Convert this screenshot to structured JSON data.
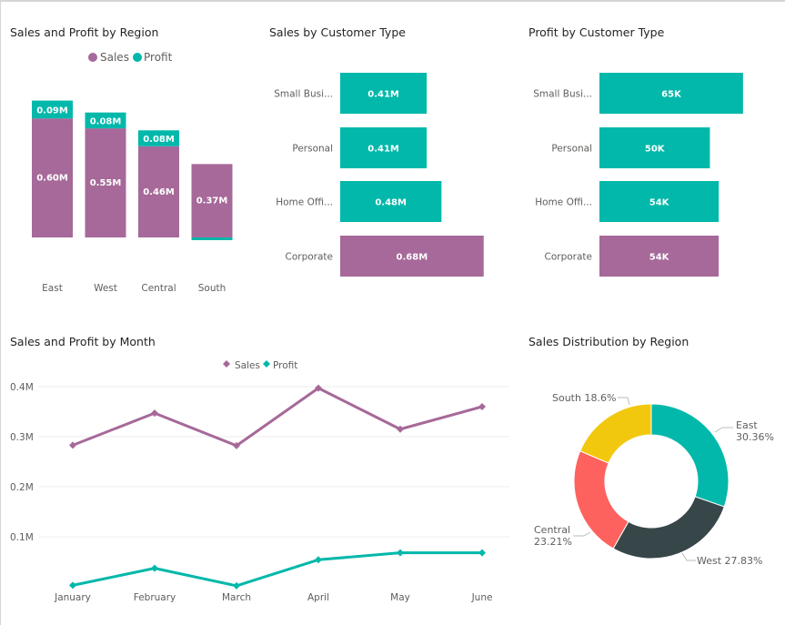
{
  "colors": {
    "sales": "#a66999",
    "profit": "#01b8aa",
    "east": "#01b8aa",
    "west": "#374649",
    "central": "#fd625e",
    "south": "#f2c80f",
    "grid": "#eeeeee",
    "axis_text": "#605e5c"
  },
  "chart_data": [
    {
      "id": "region",
      "type": "bar",
      "stacked": true,
      "title": "Sales and Profit by Region",
      "legend": {
        "position": "top-center",
        "entries": [
          "Sales",
          "Profit"
        ]
      },
      "categories": [
        "East",
        "West",
        "Central",
        "South"
      ],
      "series": [
        {
          "name": "Sales",
          "values": [
            0.6,
            0.55,
            0.46,
            0.37
          ],
          "labels": [
            "0.60M",
            "0.55M",
            "0.46M",
            "0.37M"
          ]
        },
        {
          "name": "Profit",
          "values": [
            0.09,
            0.08,
            0.08,
            -0.01
          ],
          "labels": [
            "0.09M",
            "0.08M",
            "0.08M",
            ""
          ]
        }
      ],
      "unit": "M"
    },
    {
      "id": "sales_cust",
      "type": "bar",
      "orientation": "horizontal",
      "title": "Sales by Customer Type",
      "categories": [
        "Small Busi...",
        "Personal",
        "Home Offi...",
        "Corporate"
      ],
      "values": [
        0.41,
        0.41,
        0.48,
        0.68
      ],
      "labels": [
        "0.41M",
        "0.41M",
        "0.48M",
        "0.68M"
      ],
      "highlight_index": 3,
      "xlim": [
        0,
        0.72
      ]
    },
    {
      "id": "profit_cust",
      "type": "bar",
      "orientation": "horizontal",
      "title": "Profit by Customer Type",
      "categories": [
        "Small Busi...",
        "Personal",
        "Home Offi...",
        "Corporate"
      ],
      "values": [
        65,
        50,
        54,
        54
      ],
      "labels": [
        "65K",
        "50K",
        "54K",
        "54K"
      ],
      "highlight_index": 3,
      "xlim": [
        0,
        70
      ]
    },
    {
      "id": "month",
      "type": "line",
      "title": "Sales and Profit by Month",
      "legend": {
        "position": "top-center",
        "entries": [
          "Sales",
          "Profit"
        ]
      },
      "x": [
        "January",
        "February",
        "March",
        "April",
        "May",
        "June"
      ],
      "series": [
        {
          "name": "Sales",
          "values": [
            0.283,
            0.347,
            0.282,
            0.397,
            0.315,
            0.36
          ]
        },
        {
          "name": "Profit",
          "values": [
            0.003,
            0.037,
            0.002,
            0.054,
            0.068,
            0.068
          ]
        }
      ],
      "yticks": [
        0.1,
        0.2,
        0.3,
        0.4
      ],
      "ytick_labels": [
        "0.1M",
        "0.2M",
        "0.3M",
        "0.4M"
      ],
      "ylim": [
        0,
        0.4
      ],
      "grid": true
    },
    {
      "id": "dist",
      "type": "pie",
      "donut": true,
      "title": "Sales Distribution by Region",
      "slices": [
        {
          "name": "East",
          "value": 30.36,
          "label": "30.36%"
        },
        {
          "name": "West",
          "value": 27.83,
          "label": "27.83%"
        },
        {
          "name": "Central",
          "value": 23.21,
          "label": "23.21%"
        },
        {
          "name": "South",
          "value": 18.6,
          "label": "18.6%"
        }
      ]
    }
  ]
}
